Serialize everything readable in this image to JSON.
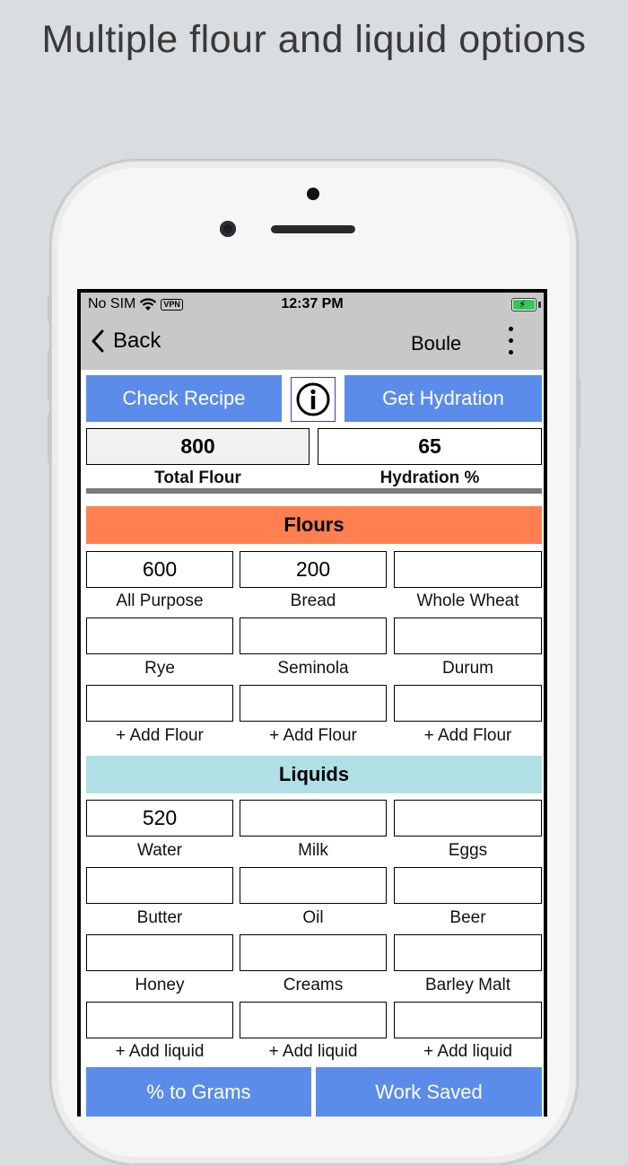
{
  "headline": "Multiple flour and liquid options",
  "status": {
    "carrier": "No SIM",
    "vpn": "VPN",
    "time": "12:37 PM"
  },
  "nav": {
    "back_label": "Back",
    "title": "Boule"
  },
  "actions": {
    "check_recipe": "Check Recipe",
    "get_hydration": "Get Hydration"
  },
  "summary": {
    "total_flour_value": "800",
    "total_flour_label": "Total Flour",
    "hydration_value": "65",
    "hydration_label": "Hydration %"
  },
  "flours": {
    "header": "Flours",
    "items": [
      {
        "value": "600",
        "label": "All Purpose"
      },
      {
        "value": "200",
        "label": "Bread"
      },
      {
        "value": "",
        "label": "Whole Wheat"
      },
      {
        "value": "",
        "label": "Rye"
      },
      {
        "value": "",
        "label": "Seminola"
      },
      {
        "value": "",
        "label": "Durum"
      },
      {
        "value": "",
        "label": "+ Add Flour"
      },
      {
        "value": "",
        "label": "+ Add Flour"
      },
      {
        "value": "",
        "label": "+ Add Flour"
      }
    ]
  },
  "liquids": {
    "header": "Liquids",
    "items": [
      {
        "value": "520",
        "label": "Water"
      },
      {
        "value": "",
        "label": "Milk"
      },
      {
        "value": "",
        "label": "Eggs"
      },
      {
        "value": "",
        "label": "Butter"
      },
      {
        "value": "",
        "label": "Oil"
      },
      {
        "value": "",
        "label": "Beer"
      },
      {
        "value": "",
        "label": "Honey"
      },
      {
        "value": "",
        "label": "Creams"
      },
      {
        "value": "",
        "label": "Barley Malt"
      },
      {
        "value": "",
        "label": "+ Add liquid"
      },
      {
        "value": "",
        "label": "+ Add liquid"
      },
      {
        "value": "",
        "label": "+ Add liquid"
      }
    ]
  },
  "footer": {
    "percent_to_grams": "% to Grams",
    "work_saved": "Work Saved"
  },
  "colors": {
    "accent_blue": "#5b8ce9",
    "flours_header": "#ff7f50",
    "liquids_header": "#b0e0e6"
  }
}
